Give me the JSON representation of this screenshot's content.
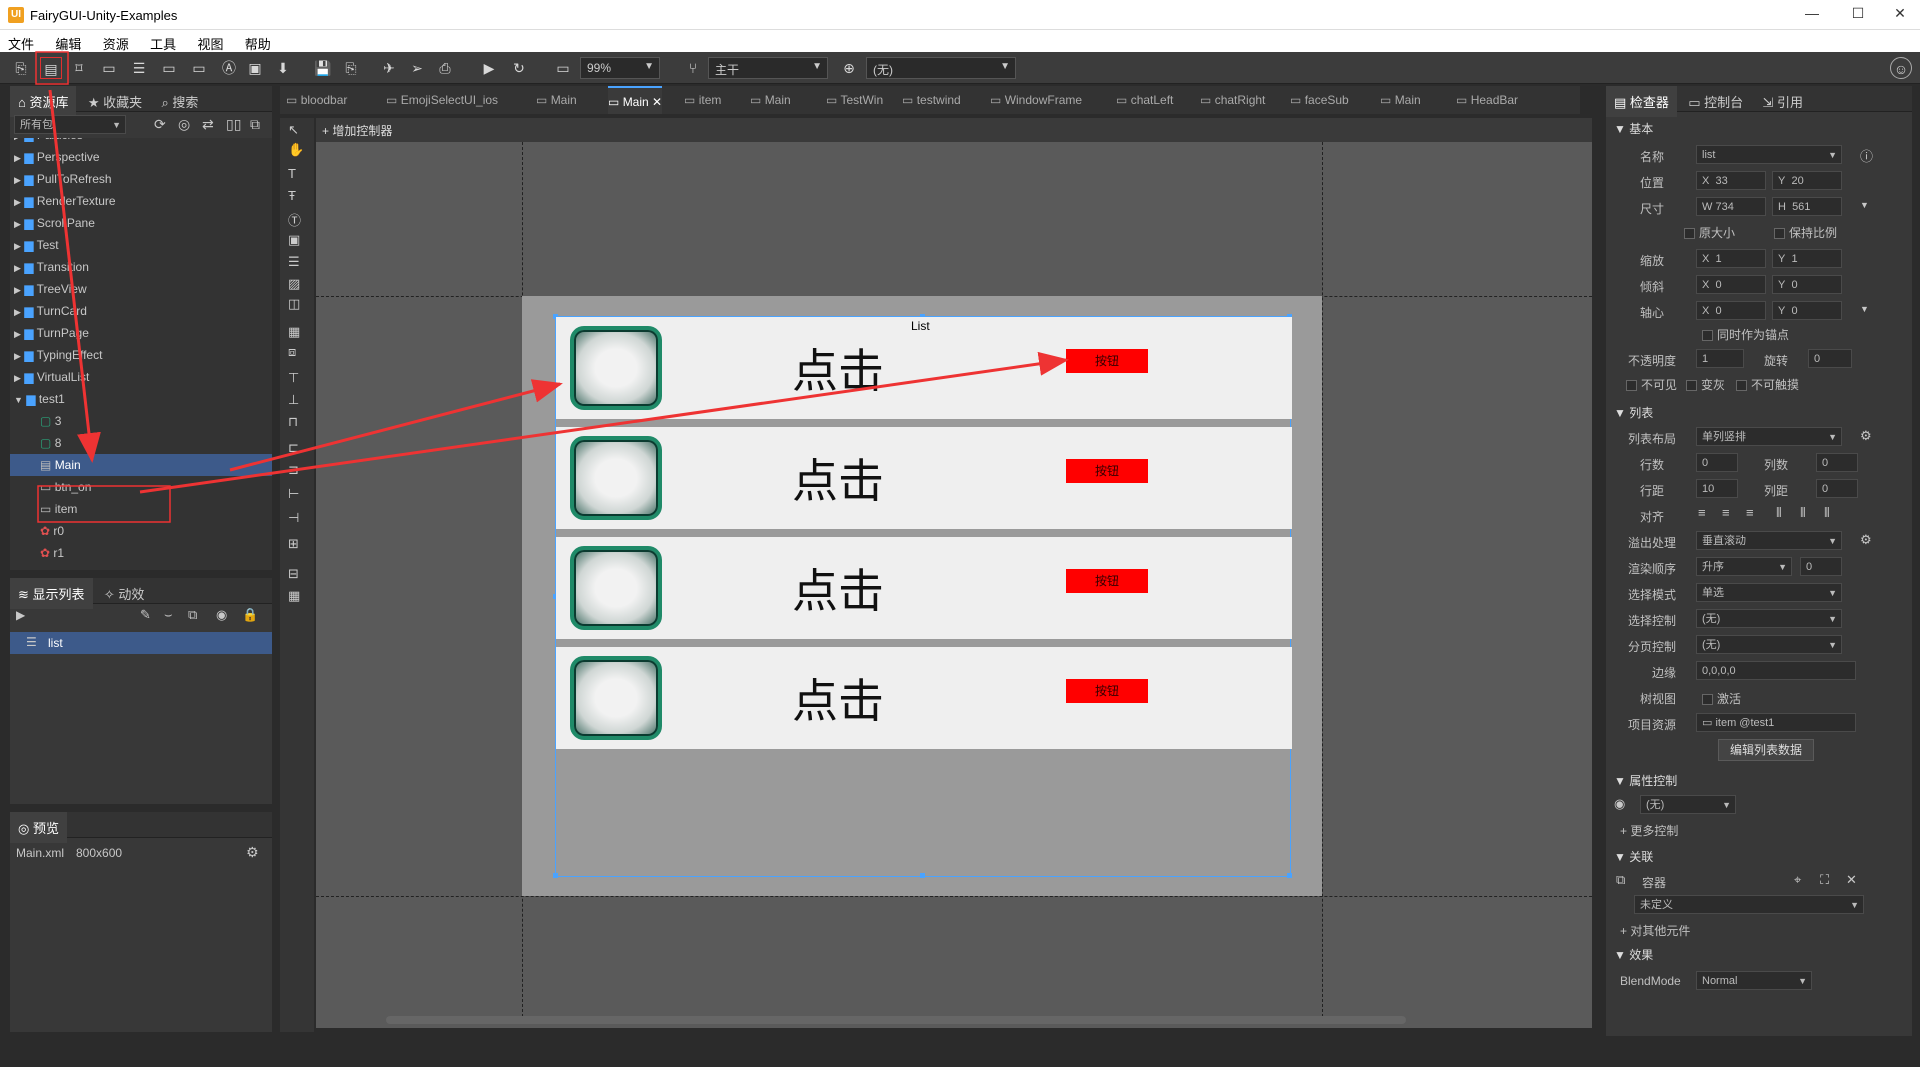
{
  "window": {
    "title": "FairyGUI-Unity-Examples",
    "logo": "UI",
    "minimize": "—",
    "maximize": "☐",
    "close": "✕"
  },
  "menu": [
    "文件",
    "编辑",
    "资源",
    "工具",
    "视图",
    "帮助"
  ],
  "toolbar": {
    "zoom": "99%",
    "branch": "主干",
    "lang": "(无)"
  },
  "library": {
    "tabs": [
      "资源库",
      "收藏夹",
      "搜索"
    ],
    "filter": "所有包",
    "items": [
      "Particles",
      "Perspective",
      "PullToRefresh",
      "RenderTexture",
      "ScrollPane",
      "Test",
      "Transition",
      "TreeView",
      "TurnCard",
      "TurnPage",
      "TypingEffect",
      "VirtualList",
      "test1"
    ],
    "children": [
      "3",
      "8",
      "Main",
      "btn_on",
      "item",
      "r0",
      "r1"
    ]
  },
  "display_list": {
    "tabs": [
      "显示列表",
      "动效"
    ],
    "item": "list"
  },
  "preview": {
    "title": "预览",
    "file": "Main.xml",
    "size": "800x600"
  },
  "doc_tabs": [
    "bloodbar",
    "EmojiSelectUI_ios",
    "Main",
    "Main",
    "item",
    "Main",
    "TestWin",
    "testwind",
    "WindowFrame",
    "chatLeft",
    "chatRight",
    "faceSub",
    "Main",
    "HeadBar"
  ],
  "canvas": {
    "add_controller": "增加控制器",
    "list_label": "List",
    "row_text": "点击",
    "button_text": "按钮",
    "rows": 4
  },
  "inspector": {
    "tabs": [
      "检查器",
      "控制台",
      "引用"
    ],
    "basic": "基本",
    "name_label": "名称",
    "name": "list",
    "pos_label": "位置",
    "x": "33",
    "y": "20",
    "size_label": "尺寸",
    "w": "734",
    "h": "561",
    "orig_size": "原大小",
    "keep_ratio": "保持比例",
    "scale_label": "缩放",
    "sx": "1",
    "sy": "1",
    "skew_label": "倾斜",
    "kx": "0",
    "ky": "0",
    "pivot_label": "轴心",
    "px": "0",
    "py": "0",
    "anchor": "同时作为锚点",
    "alpha_label": "不透明度",
    "alpha": "1",
    "rot_label": "旋转",
    "rot": "0",
    "invisible": "不可见",
    "gray": "变灰",
    "untouch": "不可触摸",
    "list": "列表",
    "layout_label": "列表布局",
    "layout": "单列竖排",
    "rows_label": "行数",
    "rows": "0",
    "cols_label": "列数",
    "cols": "0",
    "rowgap_label": "行距",
    "rowgap": "10",
    "colgap_label": "列距",
    "colgap": "0",
    "align_label": "对齐",
    "overflow_label": "溢出处理",
    "overflow": "垂直滚动",
    "render_label": "渲染顺序",
    "render": "升序",
    "render_n": "0",
    "sel_mode_label": "选择模式",
    "sel_mode": "单选",
    "sel_ctrl_label": "选择控制",
    "sel_ctrl": "(无)",
    "page_ctrl_label": "分页控制",
    "page_ctrl": "(无)",
    "margin_label": "边缘",
    "margin": "0,0,0,0",
    "tree_label": "树视图",
    "tree": "激活",
    "item_label": "项目资源",
    "item": "item @test1",
    "edit_btn": "编辑列表数据",
    "prop_ctrl": "属性控制",
    "prop_val": "(无)",
    "more_ctrl": "更多控制",
    "relation": "关联",
    "container": "容器",
    "undefined": "未定义",
    "other": "对其他元件",
    "effect": "效果",
    "blend_label": "BlendMode",
    "blend": "Normal"
  }
}
